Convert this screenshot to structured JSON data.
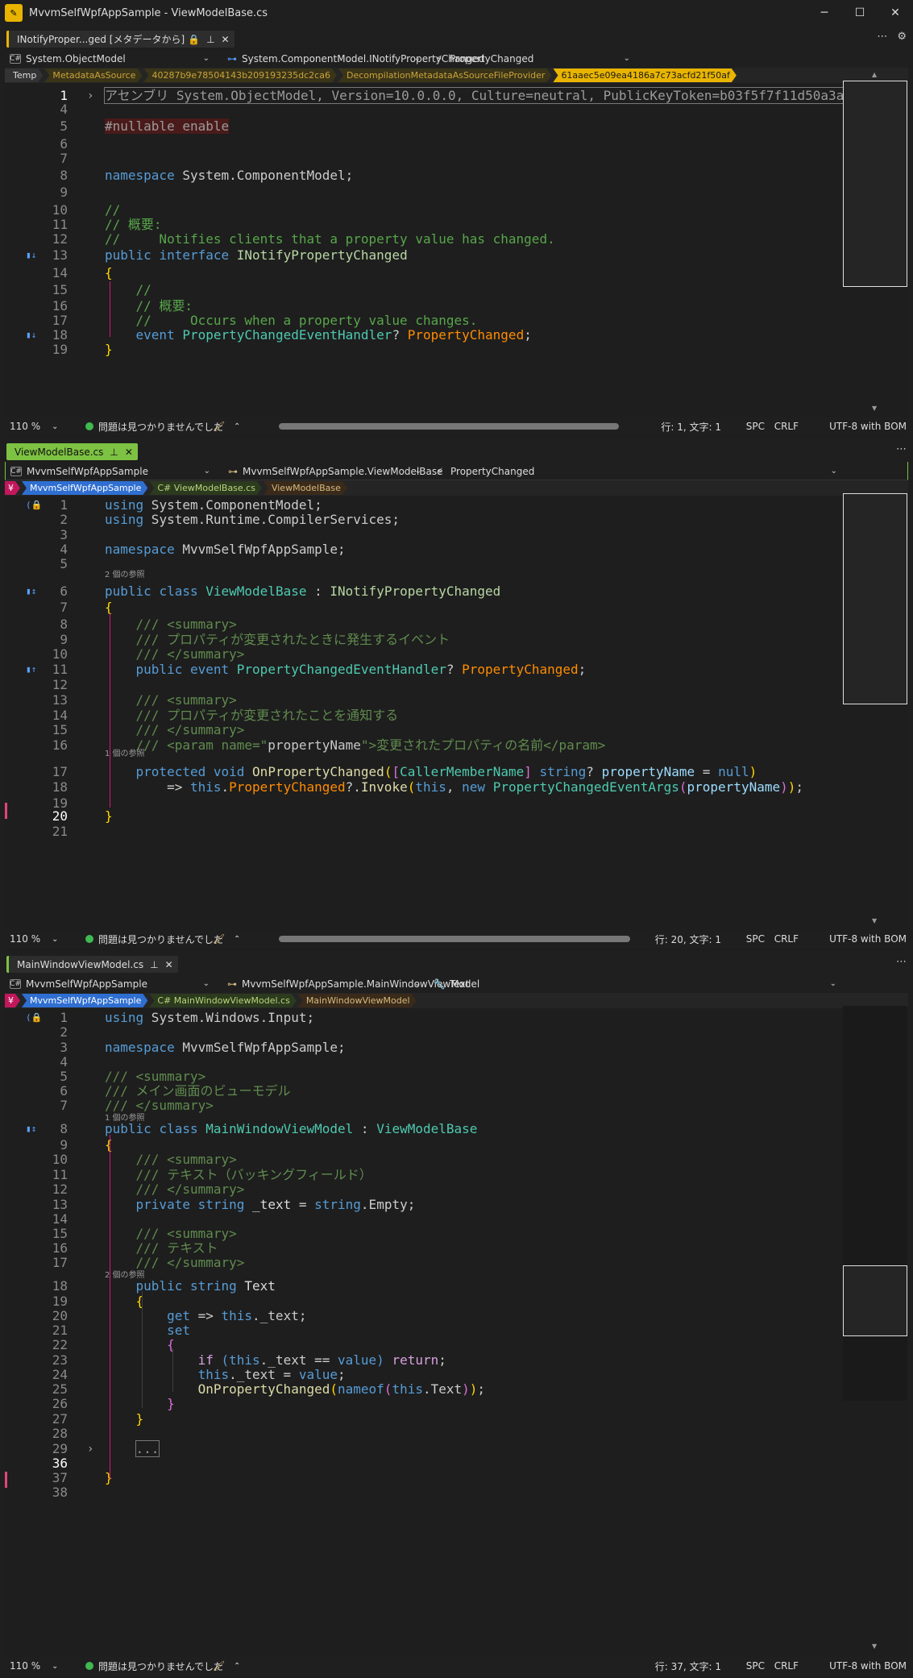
{
  "window": {
    "title": "MvvmSelfWpfAppSample - ViewModelBase.cs"
  },
  "panes": [
    {
      "tab": {
        "label": "INotifyProper...ged [メタデータから]",
        "lock": "🔒",
        "active": false
      },
      "nav": {
        "project": "System.ObjectModel",
        "type": "System.ComponentModel.INotifyPropertyChanged",
        "member": "PropertyChanged"
      },
      "crumbs": [
        "Temp",
        "MetadataAsSource",
        "40287b9e78504143b209193235dc2ca6",
        "DecompilationMetadataAsSourceFileProvider",
        "61aaec5e09ea4186a7c73acfd21f50af"
      ],
      "status": {
        "zoom": "110 %",
        "issues": "問題は見つかりませんでした",
        "position": "行: 1, 文字: 1",
        "spacing": "SPC",
        "eol": "CRLF",
        "encoding": "UTF-8 with BOM"
      },
      "lines": [
        {
          "n": "1",
          "html": "<span class='pre' style='outline:1px solid #777;'>アセンブリ System.ObjectModel, Version=10.0.0.0, Culture=neutral, PublicKeyToken=b03f5f7f11d50a3a</span>"
        },
        {
          "n": "4",
          "html": ""
        },
        {
          "n": "5",
          "html": "<span style='color:#9b9b9b;background:#4a1a1a;'>#nullable enable</span>"
        },
        {
          "n": "6",
          "html": ""
        },
        {
          "n": "7",
          "html": ""
        },
        {
          "n": "8",
          "html": "<span class='k'>namespace</span> System.ComponentModel;"
        },
        {
          "n": "9",
          "html": ""
        },
        {
          "n": "10",
          "html": "<span class='c'>//</span>"
        },
        {
          "n": "11",
          "html": "<span class='c'>// 概要:</span>"
        },
        {
          "n": "12",
          "html": "<span class='c'>//     Notifies clients that a property value has changed.</span>"
        },
        {
          "n": "13",
          "html": "<span class='k'>public</span> <span class='k'>interface</span> <span class='ti'>INotifyPropertyChanged</span>"
        },
        {
          "n": "14",
          "html": "<span class='y'>{</span>"
        },
        {
          "n": "15",
          "html": "    <span class='c'>//</span>"
        },
        {
          "n": "16",
          "html": "    <span class='c'>// 概要:</span>"
        },
        {
          "n": "17",
          "html": "    <span class='c'>//     Occurs when a property value changes.</span>"
        },
        {
          "n": "18",
          "html": "    <span class='k'>event</span> <span class='t'>PropertyChangedEventHandler</span>? <span class='e'>PropertyChanged</span>;"
        },
        {
          "n": "19",
          "html": "<span class='y'>}</span>"
        }
      ]
    },
    {
      "tab": {
        "label": "ViewModelBase.cs",
        "active": true
      },
      "nav": {
        "project": "MvvmSelfWpfAppSample",
        "type": "MvvmSelfWpfAppSample.ViewModelBase",
        "member": "PropertyChanged"
      },
      "crumbs": [
        "MvvmSelfWpfAppSample",
        "C# ViewModelBase.cs",
        "ViewModelBase"
      ],
      "status": {
        "zoom": "110 %",
        "issues": "問題は見つかりませんでした",
        "position": "行: 20, 文字: 1",
        "spacing": "SPC",
        "eol": "CRLF",
        "encoding": "UTF-8 with BOM"
      },
      "hints": {
        "h1": "2 個の参照",
        "h2": "1 個の参照"
      },
      "lines": [
        {
          "n": "1",
          "html": "<span class='k'>using</span> System.ComponentModel;"
        },
        {
          "n": "2",
          "html": "<span class='k'>using</span> System.Runtime.CompilerServices;"
        },
        {
          "n": "3",
          "html": ""
        },
        {
          "n": "4",
          "html": "<span class='k'>namespace</span> MvvmSelfWpfAppSample;"
        },
        {
          "n": "5",
          "html": ""
        },
        {
          "n": "6",
          "html": "<span class='k'>public</span> <span class='k'>class</span> <span class='t'>ViewModelBase</span> : <span class='ti'>INotifyPropertyChanged</span>"
        },
        {
          "n": "7",
          "html": "<span class='y'>{</span>"
        },
        {
          "n": "8",
          "html": "    <span class='dc'>/// &lt;summary&gt;</span>"
        },
        {
          "n": "9",
          "html": "    <span class='dc'>/// プロパティが変更されたときに発生するイベント</span>"
        },
        {
          "n": "10",
          "html": "    <span class='dc'>/// &lt;/summary&gt;</span>"
        },
        {
          "n": "11",
          "html": "    <span class='k'>public</span> <span class='k'>event</span> <span class='t'>PropertyChangedEventHandler</span>? <span class='e'>PropertyChanged</span>;"
        },
        {
          "n": "12",
          "html": ""
        },
        {
          "n": "13",
          "html": "    <span class='dc'>/// &lt;summary&gt;</span>"
        },
        {
          "n": "14",
          "html": "    <span class='dc'>/// プロパティが変更されたことを通知する</span>"
        },
        {
          "n": "15",
          "html": "    <span class='dc'>/// &lt;/summary&gt;</span>"
        },
        {
          "n": "16",
          "html": "    <span class='dc'>/// &lt;param name=\"</span><span style='color:#c8c8c8;'>propertyName</span><span class='dc'>\"&gt;変更されたプロパティの名前&lt;/param&gt;</span>"
        },
        {
          "n": "17",
          "html": "    <span class='k'>protected</span> <span class='k'>void</span> <span style='color:#dcdcaa;'>OnPropertyChanged</span><span class='y'>(</span><span class='p'>[</span><span class='t'>CallerMemberName</span><span class='p'>]</span> <span class='k'>string</span>? <span style='color:#9cdcfe;'>propertyName</span> = <span class='k'>null</span><span class='y'>)</span>"
        },
        {
          "n": "18",
          "html": "        =&gt; <span class='k'>this</span>.<span class='e'>PropertyChanged</span>?.<span style='color:#dcdcaa;'>Invoke</span><span class='y'>(</span><span class='k'>this</span>, <span class='k'>new</span> <span class='t'>PropertyChangedEventArgs</span><span class='p'>(</span><span style='color:#9cdcfe;'>propertyName</span><span class='p'>)</span><span class='y'>)</span>;"
        },
        {
          "n": "19",
          "html": ""
        },
        {
          "n": "20",
          "html": "<span class='y'>}</span>"
        },
        {
          "n": "21",
          "html": ""
        }
      ]
    },
    {
      "tab": {
        "label": "MainWindowViewModel.cs",
        "active": false
      },
      "nav": {
        "project": "MvvmSelfWpfAppSample",
        "type": "MvvmSelfWpfAppSample.MainWindowViewModel",
        "member": "Text"
      },
      "crumbs": [
        "MvvmSelfWpfAppSample",
        "C# MainWindowViewModel.cs",
        "MainWindowViewModel"
      ],
      "status": {
        "zoom": "110 %",
        "issues": "問題は見つかりませんでした",
        "position": "行: 37, 文字: 1",
        "spacing": "SPC",
        "eol": "CRLF",
        "encoding": "UTF-8 with BOM"
      },
      "hints": {
        "h1": "1 個の参照",
        "h2": "2 個の参照"
      },
      "lines": [
        {
          "n": "1",
          "html": "<span class='k'>using</span> System.Windows.Input;"
        },
        {
          "n": "2",
          "html": ""
        },
        {
          "n": "3",
          "html": "<span class='k'>namespace</span> MvvmSelfWpfAppSample;"
        },
        {
          "n": "4",
          "html": ""
        },
        {
          "n": "5",
          "html": "<span class='dc'>/// &lt;summary&gt;</span>"
        },
        {
          "n": "6",
          "html": "<span class='dc'>/// メイン画面のビューモデル</span>"
        },
        {
          "n": "7",
          "html": "<span class='dc'>/// &lt;/summary&gt;</span>"
        },
        {
          "n": "8",
          "html": "<span class='k'>public</span> <span class='k'>class</span> <span class='t'>MainWindowViewModel</span> : <span class='t'>ViewModelBase</span>"
        },
        {
          "n": "9",
          "html": "<span class='y'>{</span>"
        },
        {
          "n": "10",
          "html": "    <span class='dc'>/// &lt;summary&gt;</span>"
        },
        {
          "n": "11",
          "html": "    <span class='dc'>/// テキスト（バッキングフィールド）</span>"
        },
        {
          "n": "12",
          "html": "    <span class='dc'>/// &lt;/summary&gt;</span>"
        },
        {
          "n": "13",
          "html": "    <span class='k'>private</span> <span class='k'>string</span> <span style='color:#dadada;'>_text</span> = <span class='k'>string</span>.Empty;"
        },
        {
          "n": "14",
          "html": ""
        },
        {
          "n": "15",
          "html": "    <span class='dc'>/// &lt;summary&gt;</span>"
        },
        {
          "n": "16",
          "html": "    <span class='dc'>/// テキスト</span>"
        },
        {
          "n": "17",
          "html": "    <span class='dc'>/// &lt;/summary&gt;</span>"
        },
        {
          "n": "18",
          "html": "    <span class='k'>public</span> <span class='k'>string</span> <span style='color:#dadada;'>Text</span>"
        },
        {
          "n": "19",
          "html": "    <span class='y'>{</span>"
        },
        {
          "n": "20",
          "html": "        <span class='k'>get</span> =&gt; <span class='k'>this</span>._text;"
        },
        {
          "n": "21",
          "html": "        <span class='k'>set</span>"
        },
        {
          "n": "22",
          "html": "        <span class='p'>{</span>"
        },
        {
          "n": "23",
          "html": "            <span class='k2'>if</span> <span style='color:#569cd6;'>(</span><span class='k'>this</span>._text == <span class='k'>value</span><span style='color:#569cd6;'>)</span> <span class='k2'>return</span>;"
        },
        {
          "n": "24",
          "html": "            <span class='k'>this</span>._text = <span class='k'>value</span>;"
        },
        {
          "n": "25",
          "html": "            <span style='color:#dcdcaa;'>OnPropertyChanged</span><span class='y'>(</span><span class='k'>nameof</span><span class='p'>(</span><span class='k'>this</span>.Text<span class='p'>)</span><span class='y'>)</span>;"
        },
        {
          "n": "26",
          "html": "        <span class='p'>}</span>"
        },
        {
          "n": "27",
          "html": "    <span class='y'>}</span>"
        },
        {
          "n": "28",
          "html": ""
        },
        {
          "n": "29",
          "html": "    <span style='color:#9b9b9b;outline:1px solid #777;'>...</span>"
        },
        {
          "n": "36",
          "html": ""
        },
        {
          "n": "37",
          "html": "<span class='y'>}</span>"
        },
        {
          "n": "38",
          "html": ""
        }
      ]
    }
  ]
}
